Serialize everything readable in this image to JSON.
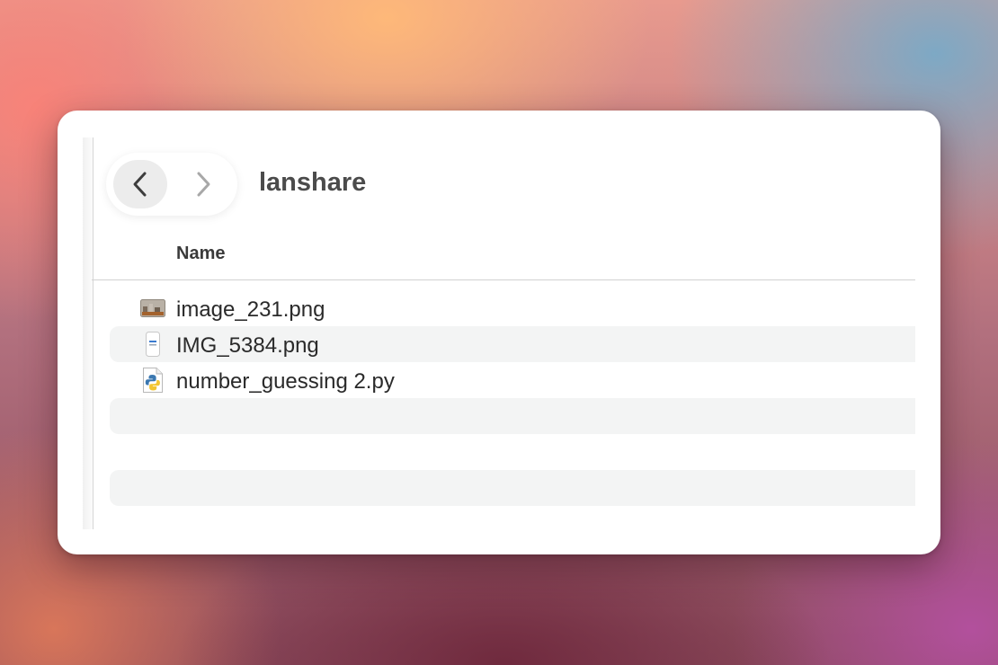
{
  "window": {
    "folder_title": "lanshare"
  },
  "navigation": {
    "back_icon": "chevron-left-icon",
    "forward_icon": "chevron-right-icon"
  },
  "table": {
    "columns": [
      "Name"
    ],
    "rows": [
      {
        "name": "image_231.png",
        "icon": "image-thumbnail-icon"
      },
      {
        "name": "IMG_5384.png",
        "icon": "phone-screenshot-thumbnail-icon"
      },
      {
        "name": "number_guessing 2.py",
        "icon": "python-file-icon"
      }
    ]
  },
  "colors": {
    "row_alt": "#f3f4f4",
    "title_text": "#4b4b4b",
    "divider": "#d2d2d2"
  }
}
